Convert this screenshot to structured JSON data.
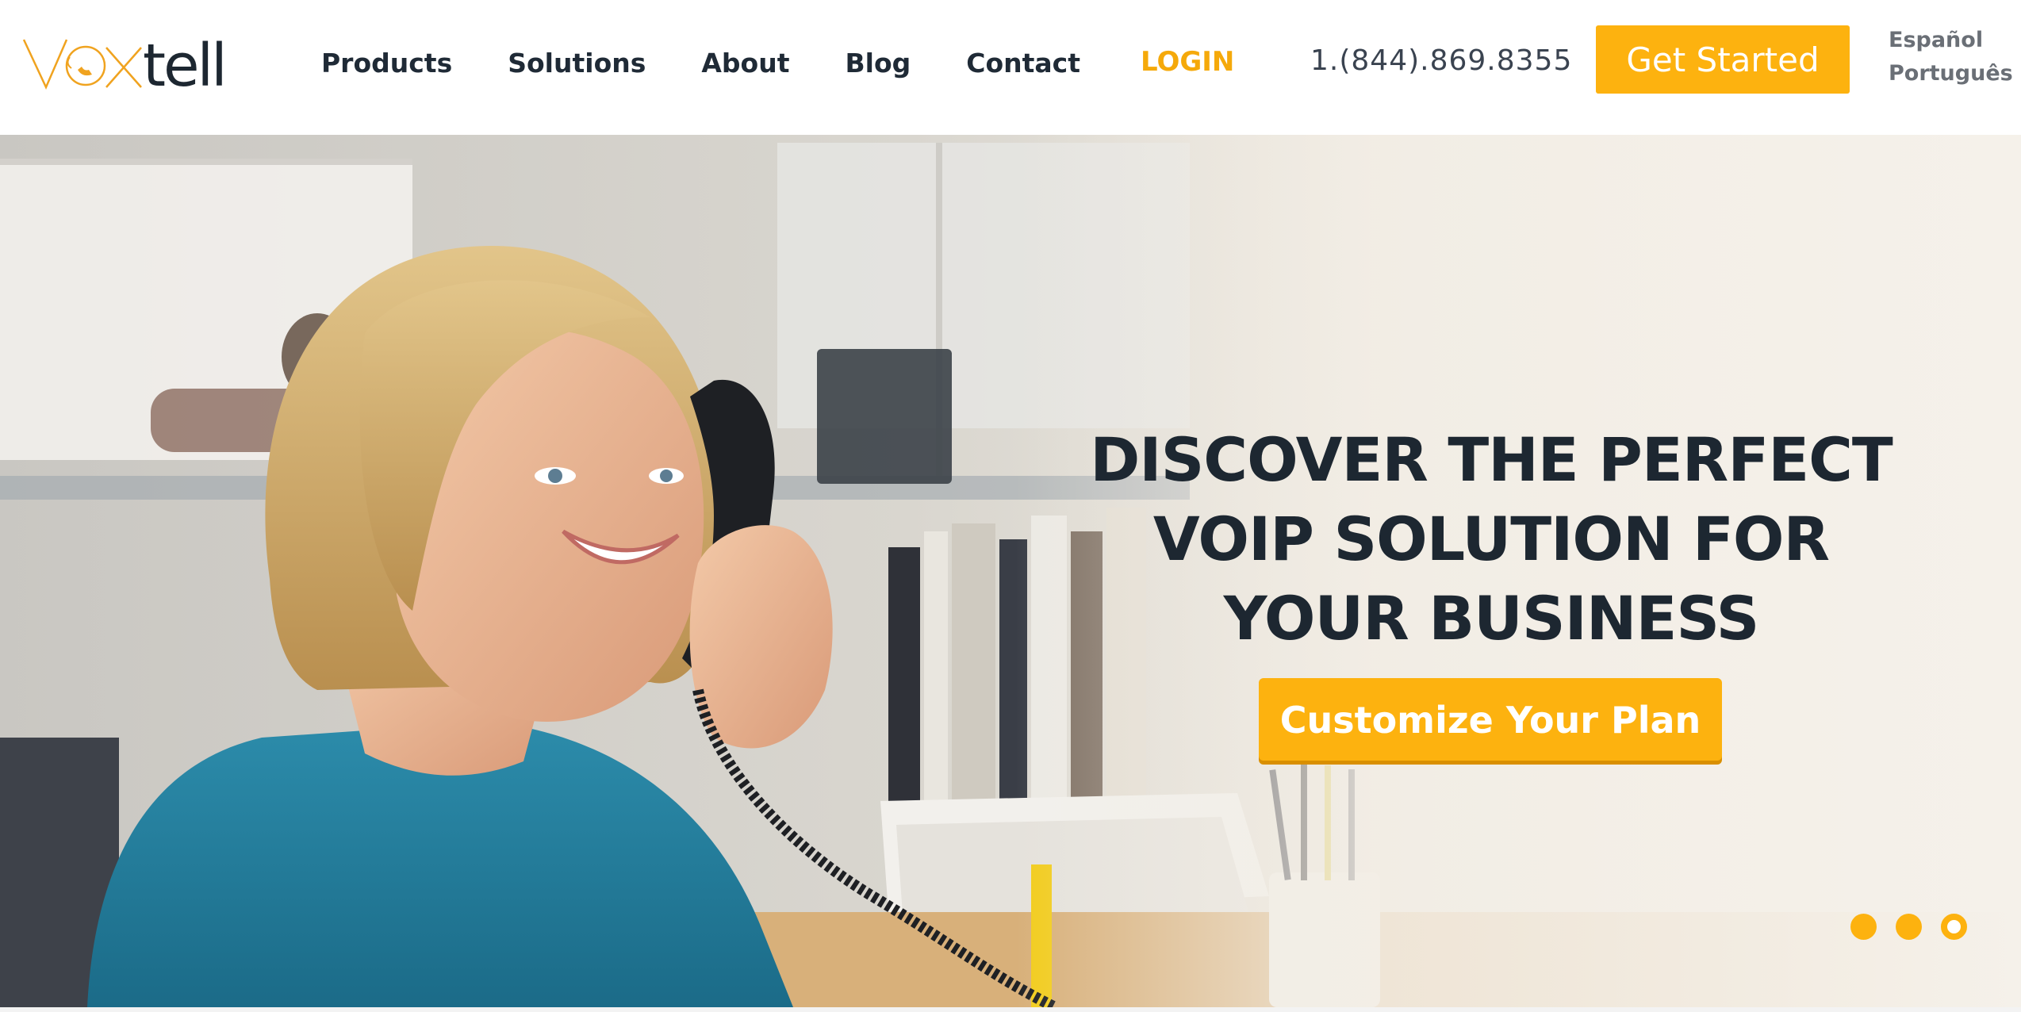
{
  "brand": {
    "logo_text": "voxtell",
    "accent_color": "#fdb20f",
    "dark_text_color": "#1f2a36"
  },
  "nav": {
    "items": [
      {
        "label": "Products"
      },
      {
        "label": "Solutions"
      },
      {
        "label": "About"
      },
      {
        "label": "Blog"
      },
      {
        "label": "Contact"
      }
    ]
  },
  "header": {
    "login_label": "LOGIN",
    "phone": "1.(844).869.8355",
    "get_started_label": "Get Started",
    "languages": [
      "Español",
      "Português"
    ]
  },
  "hero": {
    "headline_lines": [
      "DISCOVER THE PERFECT",
      "VOIP SOLUTION FOR",
      "YOUR BUSINESS"
    ],
    "cta_label": "Customize Your Plan",
    "slide_count": 3,
    "active_slide": 3
  }
}
